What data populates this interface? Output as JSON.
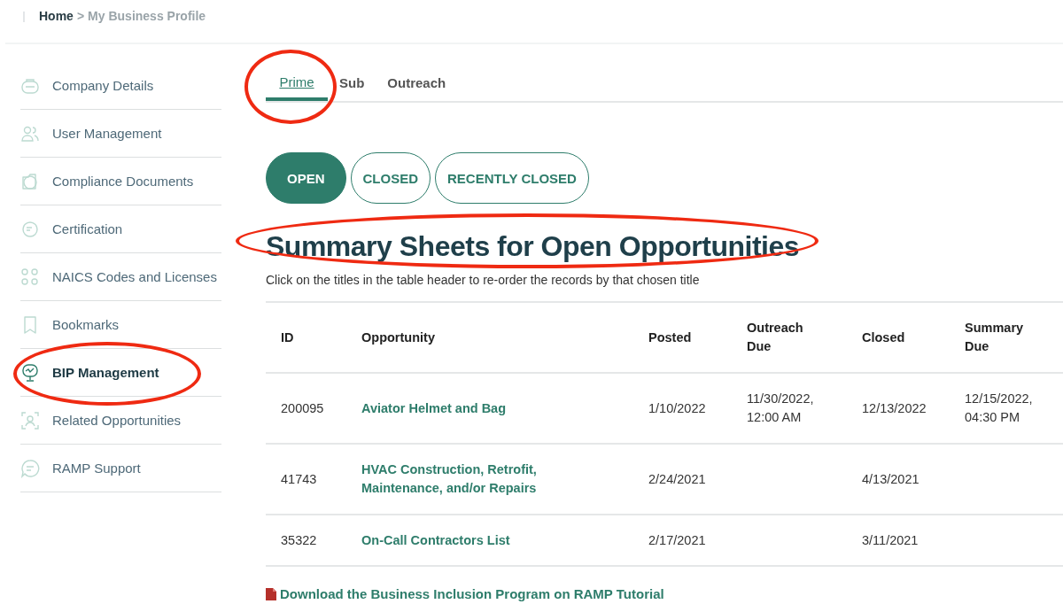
{
  "breadcrumb": {
    "home": "Home",
    "separator": ">",
    "current": "My Business Profile"
  },
  "sidebar": {
    "items": [
      {
        "label": "Company Details",
        "selected": false,
        "circled": false
      },
      {
        "label": "User Management",
        "selected": false,
        "circled": false
      },
      {
        "label": "Compliance Documents",
        "selected": false,
        "circled": false
      },
      {
        "label": "Certification",
        "selected": false,
        "circled": false
      },
      {
        "label": "NAICS Codes and Licenses",
        "selected": false,
        "circled": false
      },
      {
        "label": "Bookmarks",
        "selected": false,
        "circled": false
      },
      {
        "label": "BIP Management",
        "selected": true,
        "circled": true
      },
      {
        "label": "Related Opportunities",
        "selected": false,
        "circled": false
      },
      {
        "label": "RAMP Support",
        "selected": false,
        "circled": false
      }
    ]
  },
  "tabs": [
    {
      "label": "Prime",
      "selected": true,
      "circled": true
    },
    {
      "label": "Sub",
      "selected": false,
      "circled": false
    },
    {
      "label": "Outreach",
      "selected": false,
      "circled": false
    }
  ],
  "filters": [
    {
      "label": "OPEN",
      "selected": true
    },
    {
      "label": "CLOSED",
      "selected": false
    },
    {
      "label": "RECENTLY CLOSED",
      "selected": false
    }
  ],
  "heading": {
    "text": "Summary Sheets for Open Opportunities",
    "circled": true
  },
  "hint": "Click on the titles in the table header to re-order the records by that chosen title",
  "table": {
    "columns": [
      "ID",
      "Opportunity",
      "Posted",
      "Outreach Due",
      "Closed",
      "Summary Due"
    ],
    "rows": [
      [
        "200095",
        "Aviator Helmet and Bag",
        "1/10/2022",
        "11/30/2022, 12:00 AM",
        "12/13/2022",
        "12/15/2022, 04:30 PM"
      ],
      [
        "41743",
        "HVAC Construction, Retrofit, Maintenance, and/or Repairs",
        "2/24/2021",
        "",
        "4/13/2021",
        ""
      ],
      [
        "35322",
        "On-Call Contractors List",
        "2/17/2021",
        "",
        "3/11/2021",
        ""
      ]
    ]
  },
  "download_link": "Download the Business Inclusion Program on RAMP Tutorial"
}
